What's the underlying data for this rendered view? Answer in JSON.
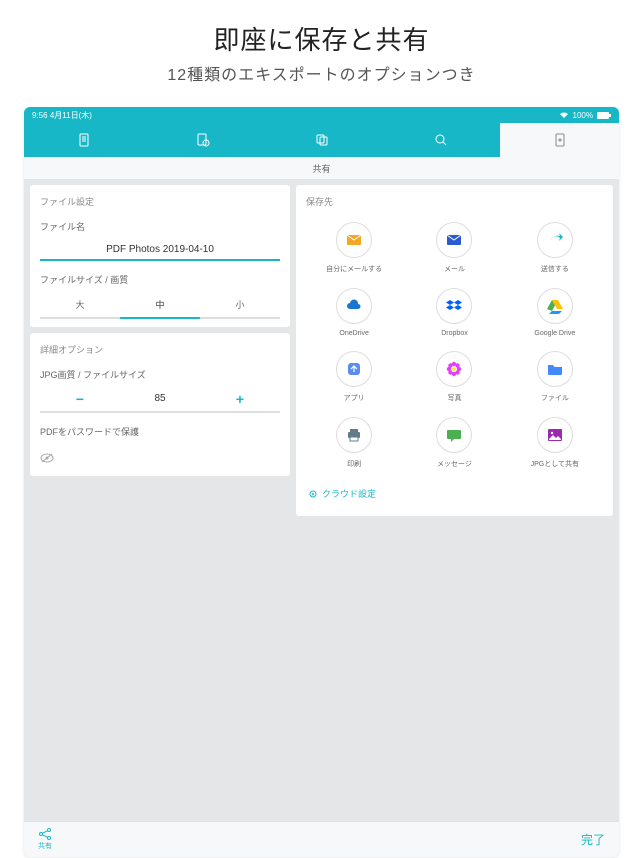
{
  "promo": {
    "title": "即座に保存と共有",
    "subtitle": "12種類のエキスポートのオプションつき"
  },
  "status": {
    "time": "9:56",
    "date": "4月11日(木)",
    "battery": "100%"
  },
  "subheader": "共有",
  "file_settings": {
    "title": "ファイル設定",
    "filename_label": "ファイル名",
    "filename_value": "PDF Photos 2019-04-10",
    "size_label": "ファイルサイズ / 画質",
    "size_options": [
      "大",
      "中",
      "小"
    ],
    "size_selected": 1
  },
  "advanced": {
    "title": "詳細オプション",
    "jpg_label": "JPG画質 / ファイルサイズ",
    "jpg_value": "85",
    "pdf_pwd_label": "PDFをパスワードで保護"
  },
  "destinations": {
    "title": "保存先",
    "items": [
      {
        "label": "自分にメールする",
        "icon": "envelope",
        "color": "#f5a623"
      },
      {
        "label": "メール",
        "icon": "envelope",
        "color": "#2a5bd0"
      },
      {
        "label": "送信する",
        "icon": "share-arrow",
        "color": "#18b7c7"
      },
      {
        "label": "OneDrive",
        "icon": "cloud",
        "color": "#1976d2"
      },
      {
        "label": "Dropbox",
        "icon": "dropbox",
        "color": "#0061ff"
      },
      {
        "label": "Google Drive",
        "icon": "gdrive",
        "color": "#4caf50"
      },
      {
        "label": "アプリ",
        "icon": "app",
        "color": "#5b8def"
      },
      {
        "label": "写真",
        "icon": "flower",
        "color": "#e040fb"
      },
      {
        "label": "ファイル",
        "icon": "folder",
        "color": "#448aff"
      },
      {
        "label": "印刷",
        "icon": "printer",
        "color": "#607d8b"
      },
      {
        "label": "メッセージ",
        "icon": "bubble",
        "color": "#4caf50"
      },
      {
        "label": "JPGとして共有",
        "icon": "image",
        "color": "#9c27b0"
      }
    ],
    "cloud_setting": "クラウド設定"
  },
  "bottom": {
    "share": "共有",
    "done": "完了"
  }
}
